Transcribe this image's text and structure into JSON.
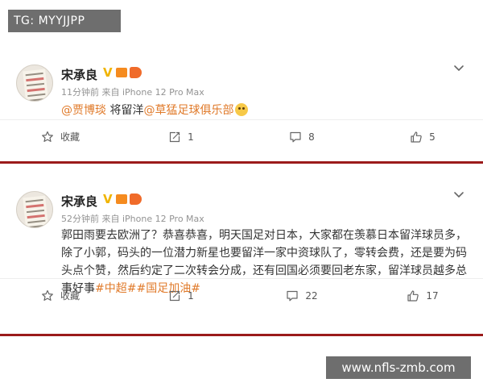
{
  "watermarks": {
    "top": "TG: MYYJJPP",
    "bottom": "www.nfls-zmb.com"
  },
  "posts": [
    {
      "username": "宋承良",
      "verified": "V",
      "meta": "11分钟前  来自 iPhone 12 Pro Max",
      "content": {
        "mention1": "@贾博琰",
        "text1": " 将留洋",
        "mention2": "@草猛足球俱乐部"
      },
      "actions": {
        "save": "收藏",
        "repost": "1",
        "comment": "8",
        "like": "5"
      }
    },
    {
      "username": "宋承良",
      "verified": "V",
      "meta": "52分钟前  来自 iPhone 12 Pro Max",
      "content": {
        "text": "郭田雨要去欧洲了？恭喜恭喜，明天国足对日本，大家都在羡慕日本留洋球员多，除了小郭，码头的一位潜力新星也要留洋一家中资球队了，零转会费，还是要为码头点个赞，然后约定了二次转会分成，还有回国必须要回老东家，留洋球员越多总事好事",
        "tags": "#中超##国足加油#"
      },
      "actions": {
        "save": "收藏",
        "repost": "1",
        "comment": "22",
        "like": "17"
      }
    }
  ],
  "colors": {
    "accent": "#e07a2a",
    "divider": "#9b1b1b",
    "verified": "#f0b400"
  },
  "icons": [
    "chevron-down-icon",
    "star-icon",
    "repost-icon",
    "comment-icon",
    "like-icon"
  ]
}
